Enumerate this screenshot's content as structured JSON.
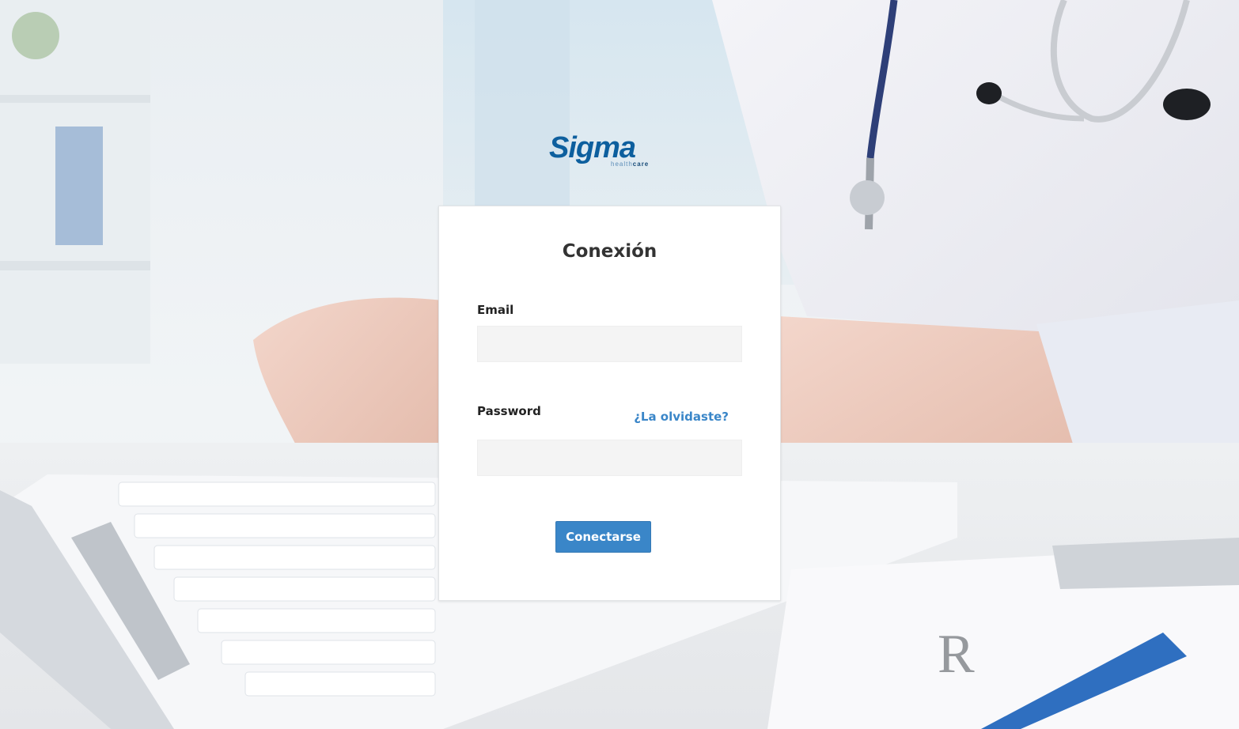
{
  "brand": {
    "name": "Sigma",
    "tagline_light": "health",
    "tagline_bold": "care",
    "primary_color": "#0d5f9e"
  },
  "login": {
    "title": "Conexión",
    "email_label": "Email",
    "email_value": "",
    "password_label": "Password",
    "password_value": "",
    "forgot_link": "¿La olvidaste?",
    "submit_label": "Conectarse",
    "accent_color": "#3a86c8"
  },
  "background": {
    "description_icon": "doctor-typing-photo"
  }
}
